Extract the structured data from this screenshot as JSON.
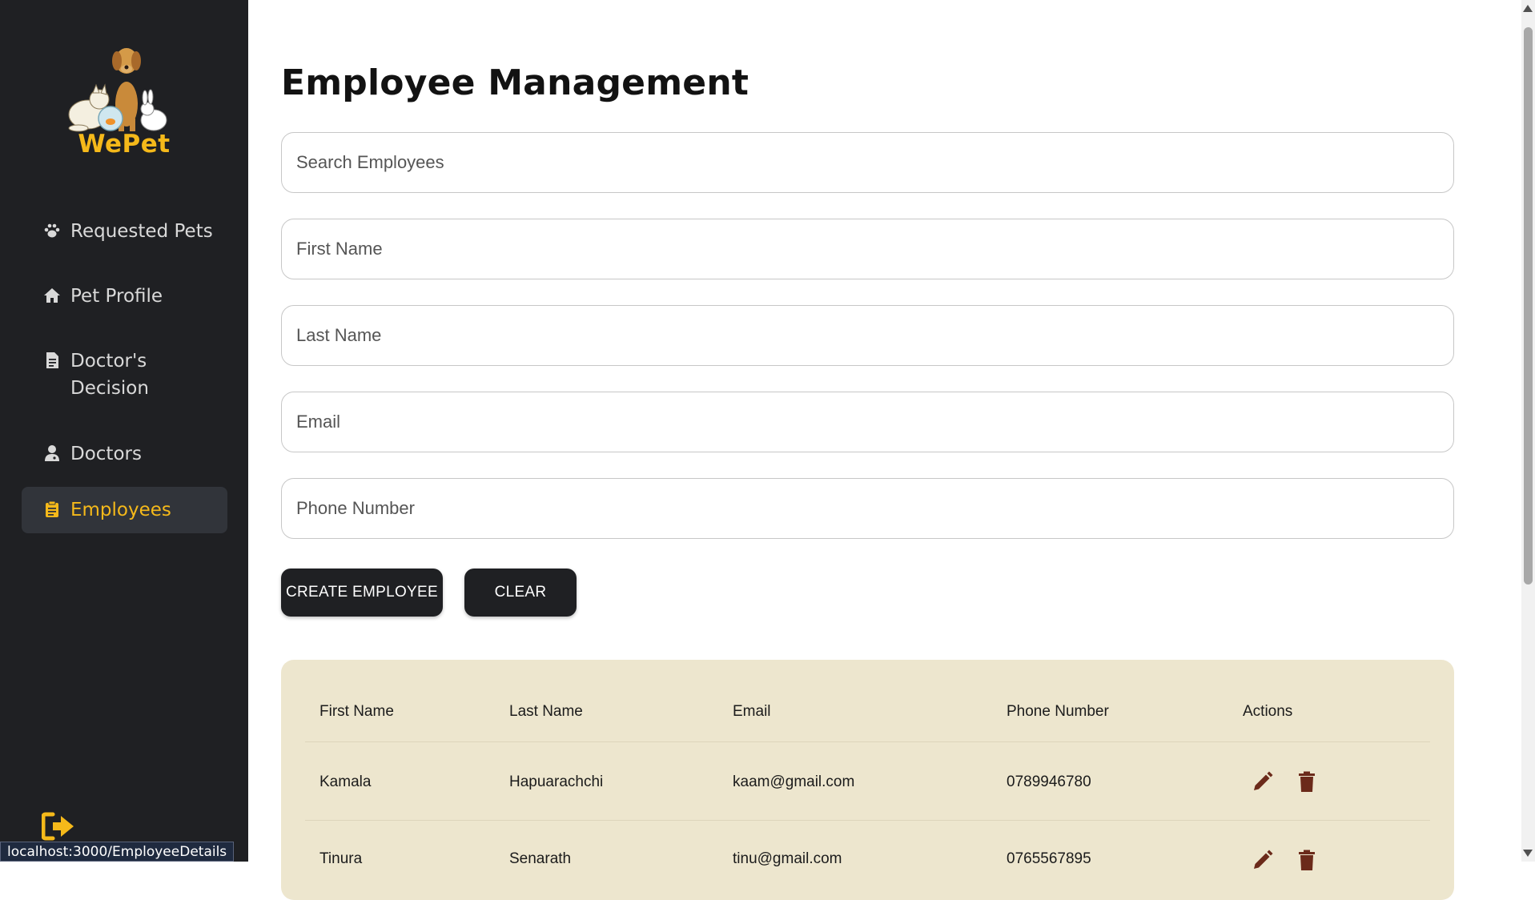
{
  "sidebar": {
    "brand": "WePet",
    "items": [
      {
        "label": "Requested Pets",
        "icon": "paw-icon"
      },
      {
        "label": "Pet Profile",
        "icon": "home-icon"
      },
      {
        "label": "Doctor's Decision",
        "icon": "document-icon"
      },
      {
        "label": "Doctors",
        "icon": "doctor-icon"
      },
      {
        "label": "Employees",
        "icon": "clipboard-icon",
        "active": true
      }
    ],
    "logout_icon": "logout-icon",
    "accent_color": "#f5b91a"
  },
  "status_url": "localhost:3000/EmployeeDetails",
  "page": {
    "title": "Employee Management",
    "search_placeholder": "Search Employees",
    "fields": {
      "first_name": "First Name",
      "last_name": "Last Name",
      "email": "Email",
      "phone": "Phone Number"
    },
    "buttons": {
      "create": "CREATE EMPLOYEE",
      "clear": "CLEAR"
    }
  },
  "table": {
    "headers": [
      "First Name",
      "Last Name",
      "Email",
      "Phone Number",
      "Actions"
    ],
    "rows": [
      {
        "first": "Kamala",
        "last": "Hapuarachchi",
        "email": "kaam@gmail.com",
        "phone": "0789946780"
      },
      {
        "first": "Tinura",
        "last": "Senarath",
        "email": "tinu@gmail.com",
        "phone": "0765567895"
      }
    ],
    "action_icons": [
      "edit-icon",
      "delete-icon"
    ],
    "action_color": "#6b2a1a",
    "background": "#ede6ce"
  }
}
